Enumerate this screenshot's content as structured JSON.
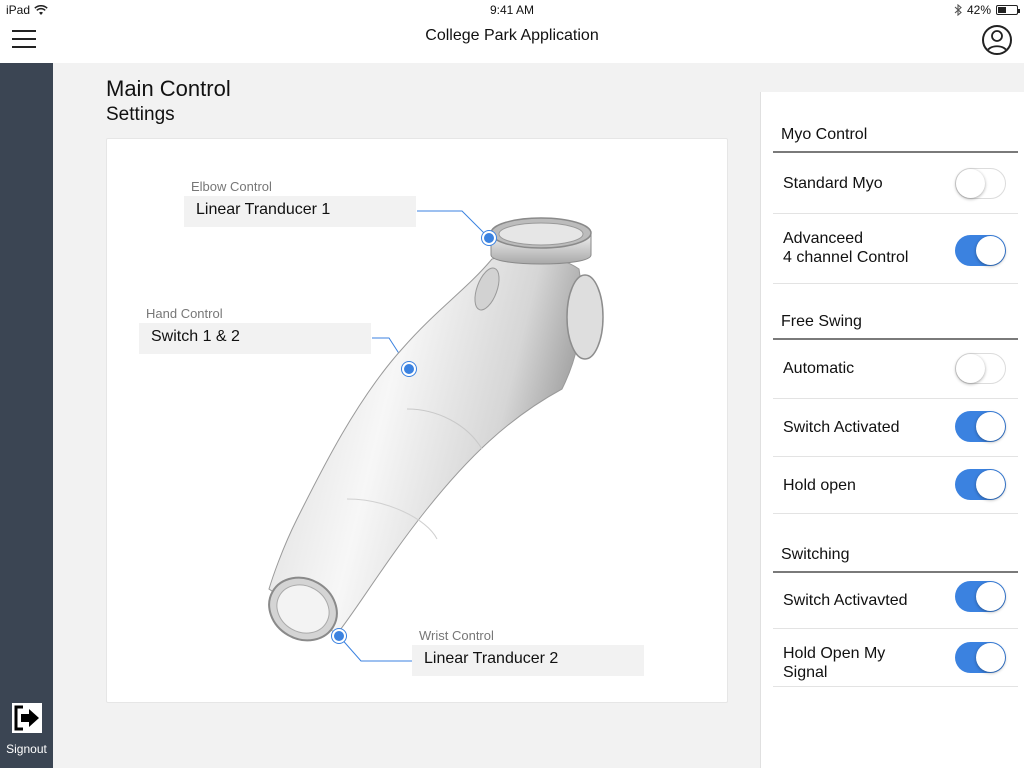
{
  "status_bar": {
    "device": "iPad",
    "time": "9:41 AM",
    "battery": "42%",
    "battery_level": 0.42,
    "icons": [
      "wifi-icon",
      "bluetooth-icon",
      "battery-icon"
    ]
  },
  "navbar": {
    "title": "College Park Application",
    "menu_icon": "hamburger-menu-icon",
    "profile_icon": "user-profile-icon"
  },
  "sidebar": {
    "signout_label": "Signout",
    "signout_icon": "signout-icon"
  },
  "main": {
    "title": "Main Control",
    "subtitle": "Settings",
    "callouts": {
      "elbow": {
        "caption": "Elbow Control",
        "value": "Linear Tranducer 1"
      },
      "hand": {
        "caption": "Hand Control",
        "value": "Switch 1 & 2"
      },
      "wrist": {
        "caption": "Wrist Control",
        "value": "Linear Tranducer 2"
      }
    },
    "accent_color": "#3b82e0"
  },
  "panel": {
    "myo": {
      "heading": "Myo Control",
      "items": [
        {
          "label": "Standard Myo",
          "on": false
        },
        {
          "label": "Advanceed\n4 channel Control",
          "on": true
        }
      ]
    },
    "free_swing": {
      "heading": "Free Swing",
      "items": [
        {
          "label": "Automatic",
          "on": false
        },
        {
          "label": "Switch Activated",
          "on": true
        },
        {
          "label": "Hold open",
          "on": true
        }
      ]
    },
    "switching": {
      "heading": "Switching",
      "items": [
        {
          "label": "Switch Activavted",
          "on": true
        },
        {
          "label": "Hold Open My\nSignal",
          "on": true
        }
      ]
    }
  },
  "colors": {
    "sidebar": "#3b4553",
    "toggle_on": "#3b82e0"
  }
}
